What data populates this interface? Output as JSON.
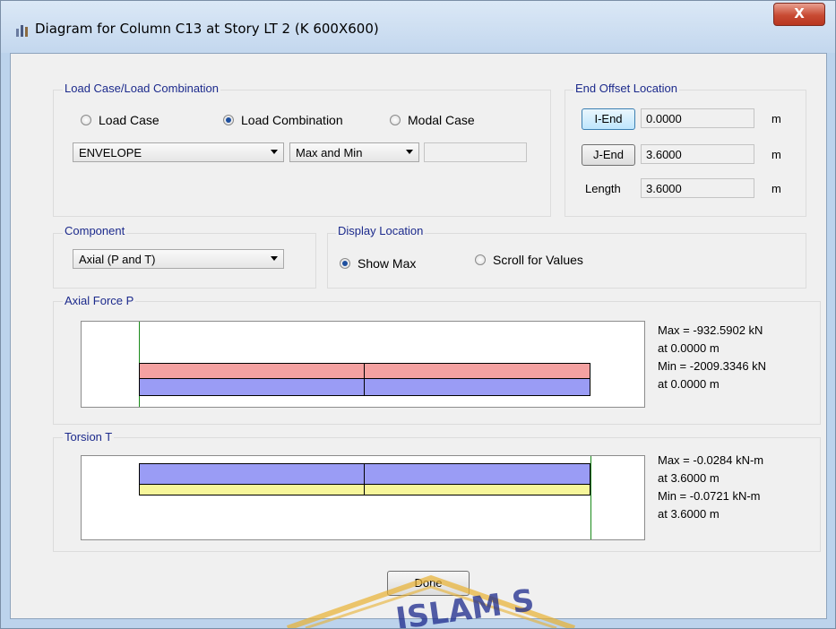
{
  "window": {
    "title": "Diagram for Column C13 at Story LT 2 (K 600X600)",
    "close_label": "X"
  },
  "load_case": {
    "group_label": "Load Case/Load Combination",
    "options": [
      {
        "label": "Load Case",
        "selected": false
      },
      {
        "label": "Load Combination",
        "selected": true
      },
      {
        "label": "Modal Case",
        "selected": false
      }
    ],
    "combo_value": "ENVELOPE",
    "type_value": "Max and Min",
    "extra_value": ""
  },
  "end_offset": {
    "group_label": "End Offset Location",
    "i_end_label": "I-End",
    "i_end_value": "0.0000",
    "j_end_label": "J-End",
    "j_end_value": "3.6000",
    "length_label": "Length",
    "length_value": "3.6000",
    "unit": "m"
  },
  "component": {
    "group_label": "Component",
    "value": "Axial (P and T)"
  },
  "display_location": {
    "group_label": "Display Location",
    "options": [
      {
        "label": "Show Max",
        "selected": true
      },
      {
        "label": "Scroll for Values",
        "selected": false
      }
    ]
  },
  "axial": {
    "group_label": "Axial Force P",
    "max_line": "Max = -932.5902 kN",
    "max_at": "at 0.0000 m",
    "min_line": "Min = -2009.3346 kN",
    "min_at": "at 0.0000 m"
  },
  "torsion": {
    "group_label": "Torsion T",
    "max_line": "Max = -0.0284 kN-m",
    "max_at": "at 3.6000 m",
    "min_line": "Min = -0.0721 kN-m",
    "min_at": "at 3.6000 m"
  },
  "done_label": "Done",
  "watermark_text": "ISLAM S",
  "colors": {
    "max_fill": "#f4a1a1",
    "min_fill": "#9a9cf5",
    "torsion_small": "#f7f69a",
    "axis_green": "#1a8a1a",
    "label_blue": "#1c2a8c"
  }
}
